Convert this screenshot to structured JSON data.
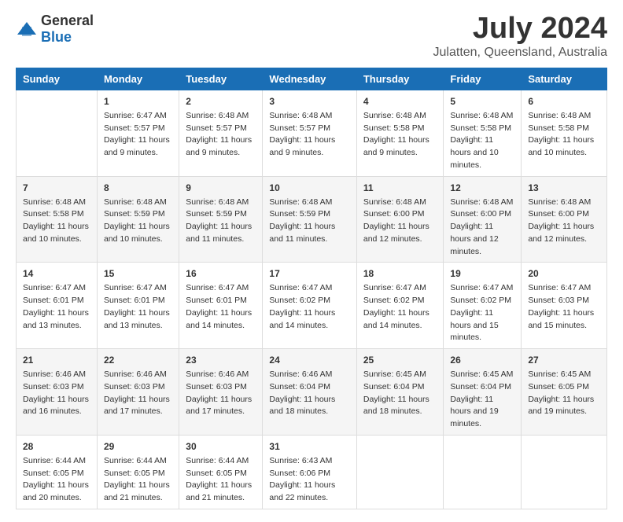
{
  "logo": {
    "general": "General",
    "blue": "Blue"
  },
  "header": {
    "title": "July 2024",
    "subtitle": "Julatten, Queensland, Australia"
  },
  "days_of_week": [
    "Sunday",
    "Monday",
    "Tuesday",
    "Wednesday",
    "Thursday",
    "Friday",
    "Saturday"
  ],
  "weeks": [
    [
      {
        "date": "",
        "sunrise": "",
        "sunset": "",
        "daylight": ""
      },
      {
        "date": "1",
        "sunrise": "Sunrise: 6:47 AM",
        "sunset": "Sunset: 5:57 PM",
        "daylight": "Daylight: 11 hours and 9 minutes."
      },
      {
        "date": "2",
        "sunrise": "Sunrise: 6:48 AM",
        "sunset": "Sunset: 5:57 PM",
        "daylight": "Daylight: 11 hours and 9 minutes."
      },
      {
        "date": "3",
        "sunrise": "Sunrise: 6:48 AM",
        "sunset": "Sunset: 5:57 PM",
        "daylight": "Daylight: 11 hours and 9 minutes."
      },
      {
        "date": "4",
        "sunrise": "Sunrise: 6:48 AM",
        "sunset": "Sunset: 5:58 PM",
        "daylight": "Daylight: 11 hours and 9 minutes."
      },
      {
        "date": "5",
        "sunrise": "Sunrise: 6:48 AM",
        "sunset": "Sunset: 5:58 PM",
        "daylight": "Daylight: 11 hours and 10 minutes."
      },
      {
        "date": "6",
        "sunrise": "Sunrise: 6:48 AM",
        "sunset": "Sunset: 5:58 PM",
        "daylight": "Daylight: 11 hours and 10 minutes."
      }
    ],
    [
      {
        "date": "7",
        "sunrise": "Sunrise: 6:48 AM",
        "sunset": "Sunset: 5:58 PM",
        "daylight": "Daylight: 11 hours and 10 minutes."
      },
      {
        "date": "8",
        "sunrise": "Sunrise: 6:48 AM",
        "sunset": "Sunset: 5:59 PM",
        "daylight": "Daylight: 11 hours and 10 minutes."
      },
      {
        "date": "9",
        "sunrise": "Sunrise: 6:48 AM",
        "sunset": "Sunset: 5:59 PM",
        "daylight": "Daylight: 11 hours and 11 minutes."
      },
      {
        "date": "10",
        "sunrise": "Sunrise: 6:48 AM",
        "sunset": "Sunset: 5:59 PM",
        "daylight": "Daylight: 11 hours and 11 minutes."
      },
      {
        "date": "11",
        "sunrise": "Sunrise: 6:48 AM",
        "sunset": "Sunset: 6:00 PM",
        "daylight": "Daylight: 11 hours and 12 minutes."
      },
      {
        "date": "12",
        "sunrise": "Sunrise: 6:48 AM",
        "sunset": "Sunset: 6:00 PM",
        "daylight": "Daylight: 11 hours and 12 minutes."
      },
      {
        "date": "13",
        "sunrise": "Sunrise: 6:48 AM",
        "sunset": "Sunset: 6:00 PM",
        "daylight": "Daylight: 11 hours and 12 minutes."
      }
    ],
    [
      {
        "date": "14",
        "sunrise": "Sunrise: 6:47 AM",
        "sunset": "Sunset: 6:01 PM",
        "daylight": "Daylight: 11 hours and 13 minutes."
      },
      {
        "date": "15",
        "sunrise": "Sunrise: 6:47 AM",
        "sunset": "Sunset: 6:01 PM",
        "daylight": "Daylight: 11 hours and 13 minutes."
      },
      {
        "date": "16",
        "sunrise": "Sunrise: 6:47 AM",
        "sunset": "Sunset: 6:01 PM",
        "daylight": "Daylight: 11 hours and 14 minutes."
      },
      {
        "date": "17",
        "sunrise": "Sunrise: 6:47 AM",
        "sunset": "Sunset: 6:02 PM",
        "daylight": "Daylight: 11 hours and 14 minutes."
      },
      {
        "date": "18",
        "sunrise": "Sunrise: 6:47 AM",
        "sunset": "Sunset: 6:02 PM",
        "daylight": "Daylight: 11 hours and 14 minutes."
      },
      {
        "date": "19",
        "sunrise": "Sunrise: 6:47 AM",
        "sunset": "Sunset: 6:02 PM",
        "daylight": "Daylight: 11 hours and 15 minutes."
      },
      {
        "date": "20",
        "sunrise": "Sunrise: 6:47 AM",
        "sunset": "Sunset: 6:03 PM",
        "daylight": "Daylight: 11 hours and 15 minutes."
      }
    ],
    [
      {
        "date": "21",
        "sunrise": "Sunrise: 6:46 AM",
        "sunset": "Sunset: 6:03 PM",
        "daylight": "Daylight: 11 hours and 16 minutes."
      },
      {
        "date": "22",
        "sunrise": "Sunrise: 6:46 AM",
        "sunset": "Sunset: 6:03 PM",
        "daylight": "Daylight: 11 hours and 17 minutes."
      },
      {
        "date": "23",
        "sunrise": "Sunrise: 6:46 AM",
        "sunset": "Sunset: 6:03 PM",
        "daylight": "Daylight: 11 hours and 17 minutes."
      },
      {
        "date": "24",
        "sunrise": "Sunrise: 6:46 AM",
        "sunset": "Sunset: 6:04 PM",
        "daylight": "Daylight: 11 hours and 18 minutes."
      },
      {
        "date": "25",
        "sunrise": "Sunrise: 6:45 AM",
        "sunset": "Sunset: 6:04 PM",
        "daylight": "Daylight: 11 hours and 18 minutes."
      },
      {
        "date": "26",
        "sunrise": "Sunrise: 6:45 AM",
        "sunset": "Sunset: 6:04 PM",
        "daylight": "Daylight: 11 hours and 19 minutes."
      },
      {
        "date": "27",
        "sunrise": "Sunrise: 6:45 AM",
        "sunset": "Sunset: 6:05 PM",
        "daylight": "Daylight: 11 hours and 19 minutes."
      }
    ],
    [
      {
        "date": "28",
        "sunrise": "Sunrise: 6:44 AM",
        "sunset": "Sunset: 6:05 PM",
        "daylight": "Daylight: 11 hours and 20 minutes."
      },
      {
        "date": "29",
        "sunrise": "Sunrise: 6:44 AM",
        "sunset": "Sunset: 6:05 PM",
        "daylight": "Daylight: 11 hours and 21 minutes."
      },
      {
        "date": "30",
        "sunrise": "Sunrise: 6:44 AM",
        "sunset": "Sunset: 6:05 PM",
        "daylight": "Daylight: 11 hours and 21 minutes."
      },
      {
        "date": "31",
        "sunrise": "Sunrise: 6:43 AM",
        "sunset": "Sunset: 6:06 PM",
        "daylight": "Daylight: 11 hours and 22 minutes."
      },
      {
        "date": "",
        "sunrise": "",
        "sunset": "",
        "daylight": ""
      },
      {
        "date": "",
        "sunrise": "",
        "sunset": "",
        "daylight": ""
      },
      {
        "date": "",
        "sunrise": "",
        "sunset": "",
        "daylight": ""
      }
    ]
  ]
}
